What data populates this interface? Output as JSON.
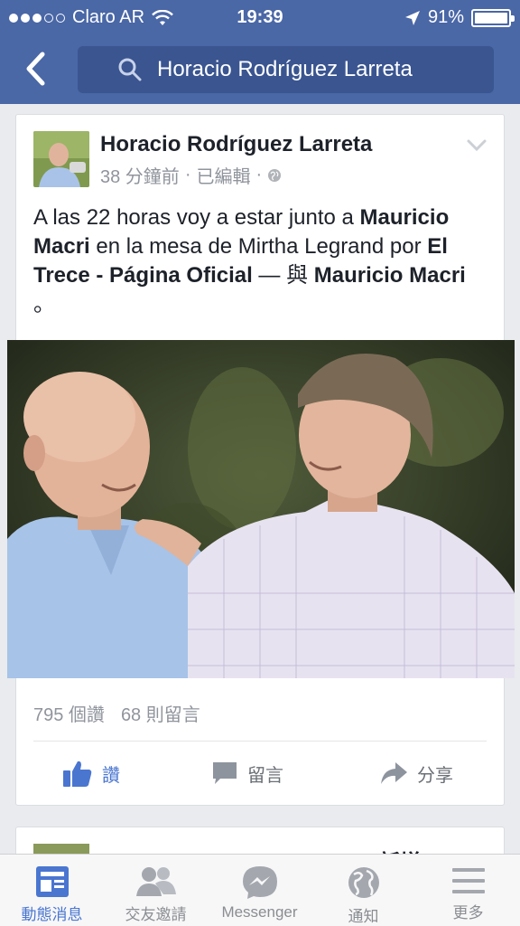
{
  "status_bar": {
    "carrier": "Claro AR",
    "time": "19:39",
    "battery": "91%"
  },
  "nav": {
    "search_query": "Horacio Rodríguez Larreta"
  },
  "post": {
    "author": "Horacio Rodríguez Larreta",
    "time": "38 分鐘前",
    "edited": "已編輯",
    "text_segments": [
      {
        "t": "A las 22 horas voy a estar junto a ",
        "bold": false
      },
      {
        "t": "Mauricio Macri",
        "bold": true
      },
      {
        "t": " en la mesa de Mirtha Legrand por ",
        "bold": false
      },
      {
        "t": "El Trece - Página Oficial",
        "bold": true
      },
      {
        "t": " — 與 ",
        "bold": false
      },
      {
        "t": "Mauricio Macri",
        "bold": true
      },
      {
        "t": " 。",
        "bold": false
      }
    ],
    "likes": "795 個讚",
    "comments": "68 則留言",
    "actions": {
      "like": "讚",
      "comment": "留言",
      "share": "分享"
    }
  },
  "next_post": {
    "author": "Horacio Rodríguez Larreta 新增"
  },
  "tabbar": {
    "items": [
      {
        "label": "動態消息",
        "icon": "news-feed-icon",
        "active": true
      },
      {
        "label": "交友邀請",
        "icon": "friend-requests-icon",
        "active": false
      },
      {
        "label": "Messenger",
        "icon": "messenger-icon",
        "active": false
      },
      {
        "label": "通知",
        "icon": "globe-icon",
        "active": false
      },
      {
        "label": "更多",
        "icon": "menu-icon",
        "active": false
      }
    ]
  },
  "colors": {
    "header": "#4a67a6",
    "search_bg": "#3a5590",
    "accent": "#4a76d0"
  }
}
